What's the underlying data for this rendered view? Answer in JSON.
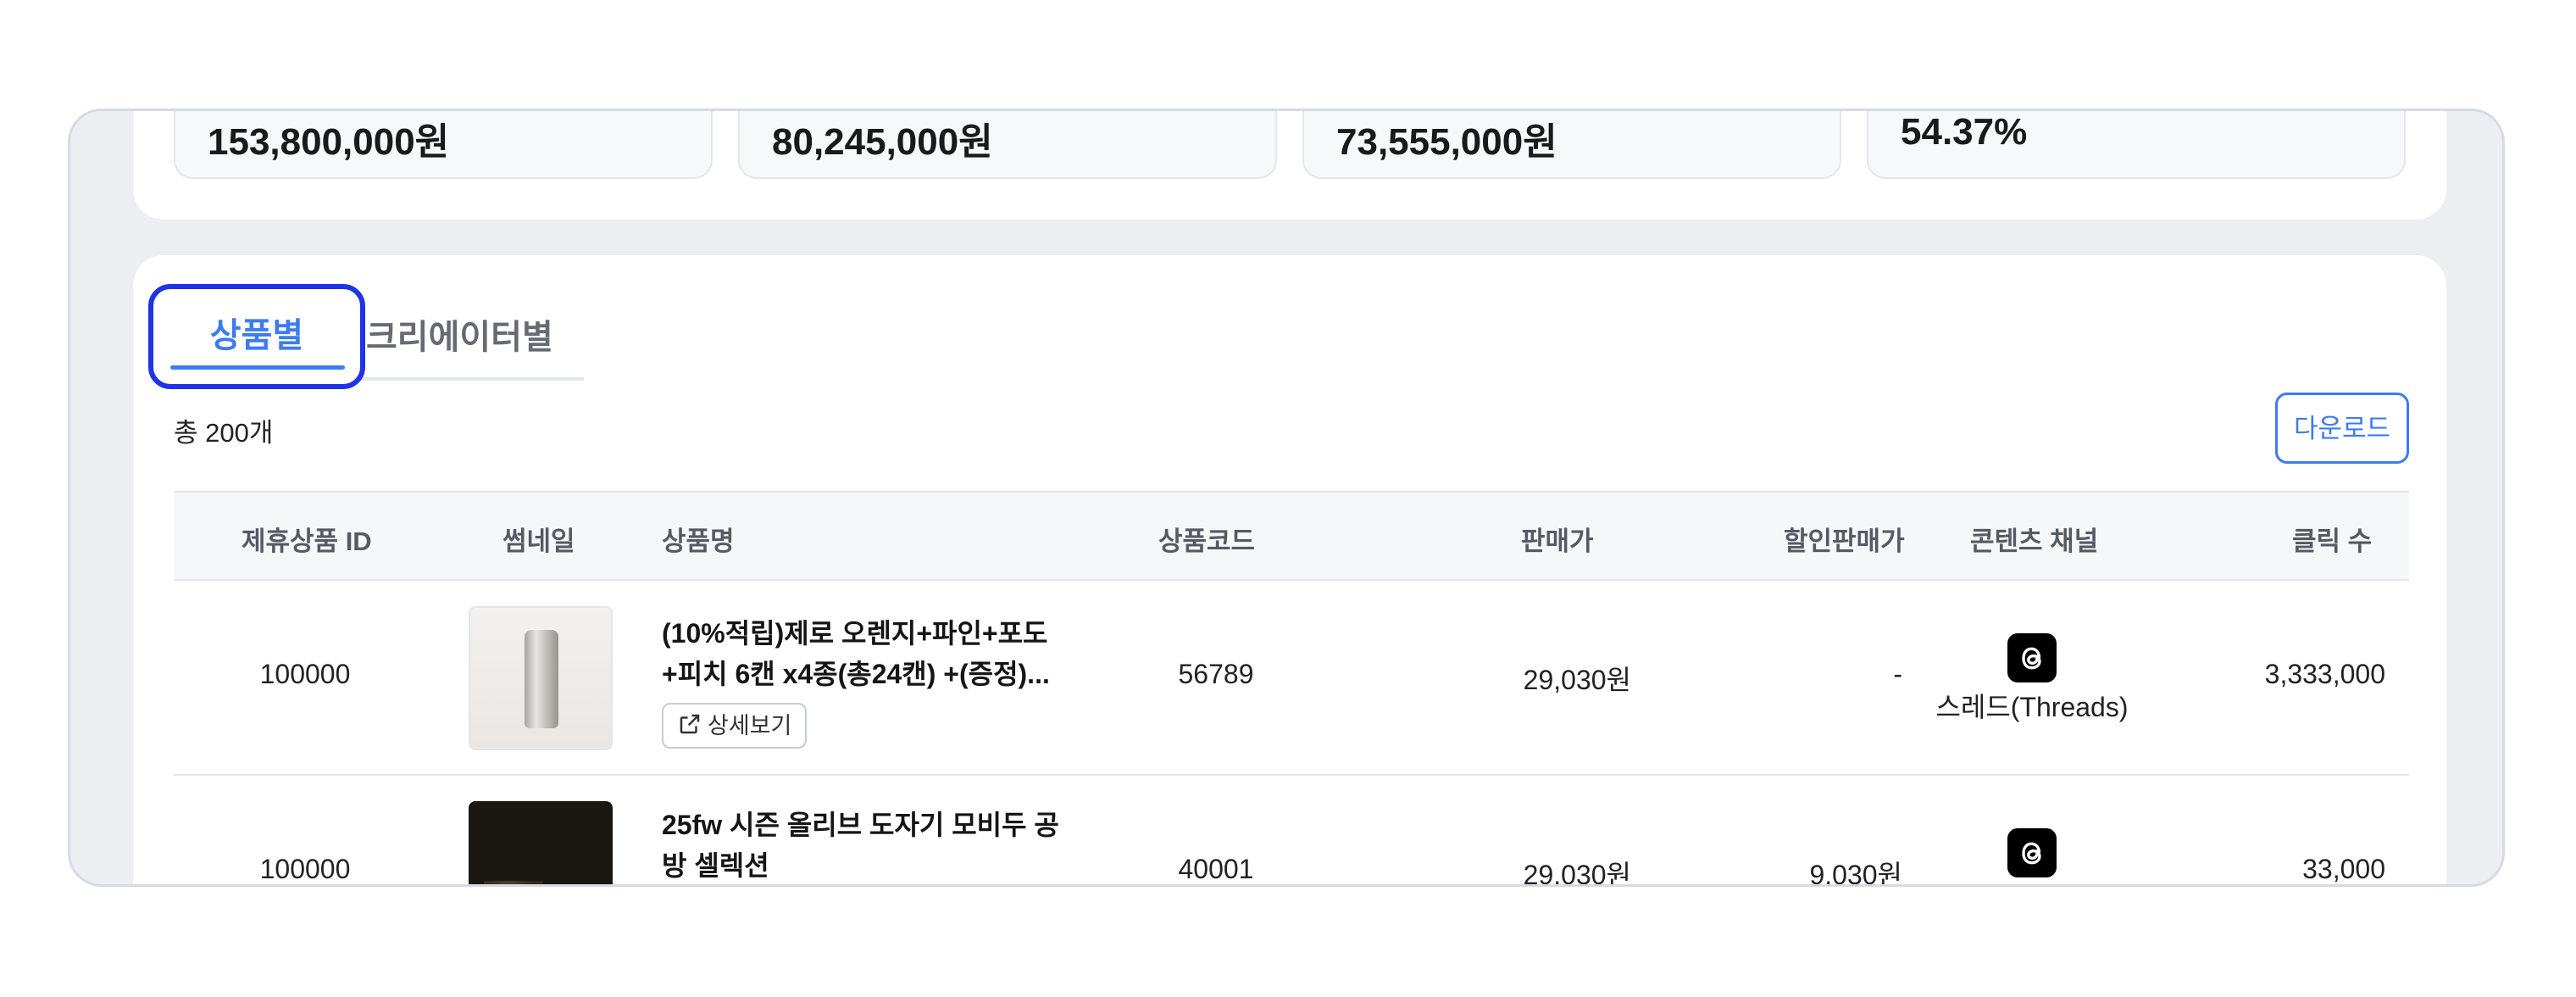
{
  "stats": {
    "values": [
      "153,800,000원",
      "80,245,000원",
      "73,555,000원",
      "54.37%"
    ]
  },
  "tabs": {
    "active_label": "상품별",
    "inactive_label": "크리에이터별"
  },
  "summary": {
    "total_text": "총 200개"
  },
  "toolbar": {
    "download_label": "다운로드"
  },
  "table": {
    "columns": [
      "제휴상품 ID",
      "썸네일",
      "상품명",
      "상품코드",
      "판매가",
      "할인판매가",
      "콘텐츠 채널",
      "클릭 수"
    ],
    "rows": [
      {
        "id": "100000",
        "thumbnail_icon": "silver-can-image",
        "name_line1": "(10%적립)제로 오렌지+파인+포도",
        "name_line2": "+피치 6캔 x4종(총24캔) +(증정)...",
        "detail_label": "상세보기",
        "code": "56789",
        "price": "29,030원",
        "discount_price": "-",
        "channel_icon": "threads-icon",
        "channel_label": "스레드(Threads)",
        "clicks": "3,333,000"
      },
      {
        "id": "100000",
        "thumbnail_icon": "ceramic-cup-image",
        "name_line1": "25fw 시즌 올리브 도자기 모비두 공",
        "name_line2": "방 셀렉션",
        "code": "40001",
        "price": "29,030원",
        "discount_price": "9,030원",
        "channel_icon": "threads-icon",
        "clicks": "33,000"
      }
    ]
  },
  "colors": {
    "accent": "#3d7cf0",
    "focus_ring": "#1f33e8",
    "frame_bg": "#eceef2"
  }
}
